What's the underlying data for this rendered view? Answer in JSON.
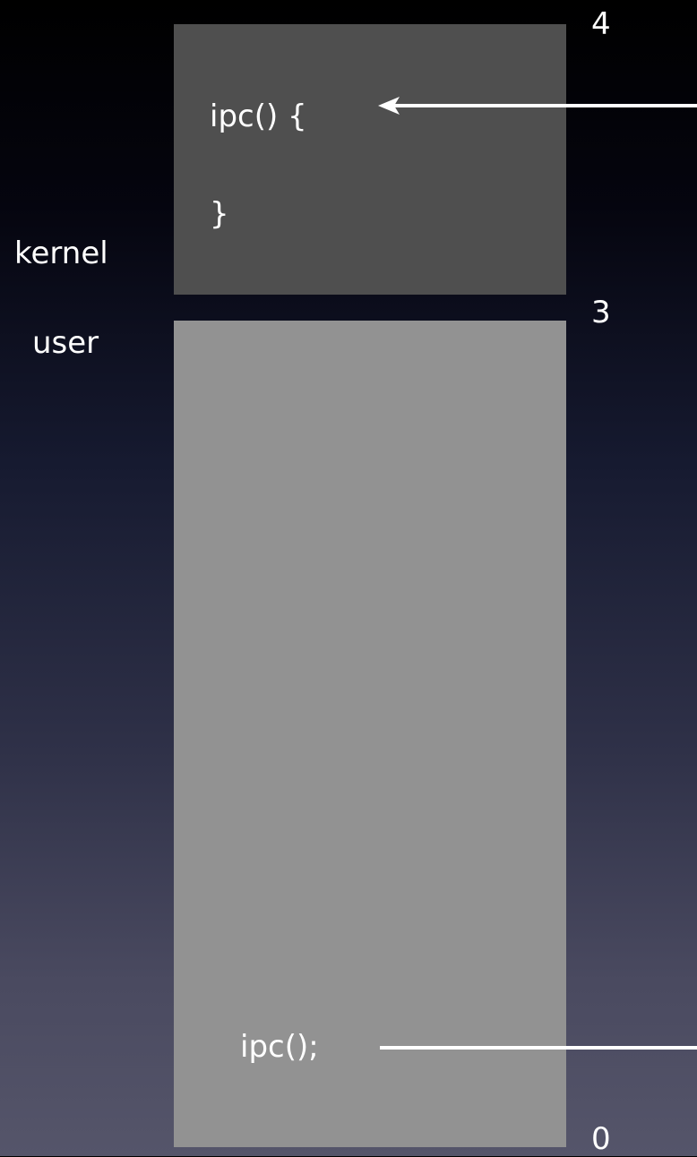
{
  "regions": {
    "kernel": {
      "label": "kernel",
      "code_open": "ipc() {",
      "code_close": "}"
    },
    "user": {
      "label": "user",
      "code_call": "ipc();"
    }
  },
  "levels": {
    "top": "4",
    "boundary": "3",
    "bottom": "0"
  },
  "colors": {
    "kernel_fill": "#4f4f4f",
    "user_fill": "#929292",
    "text": "#ffffff",
    "arrow": "#ffffff"
  }
}
